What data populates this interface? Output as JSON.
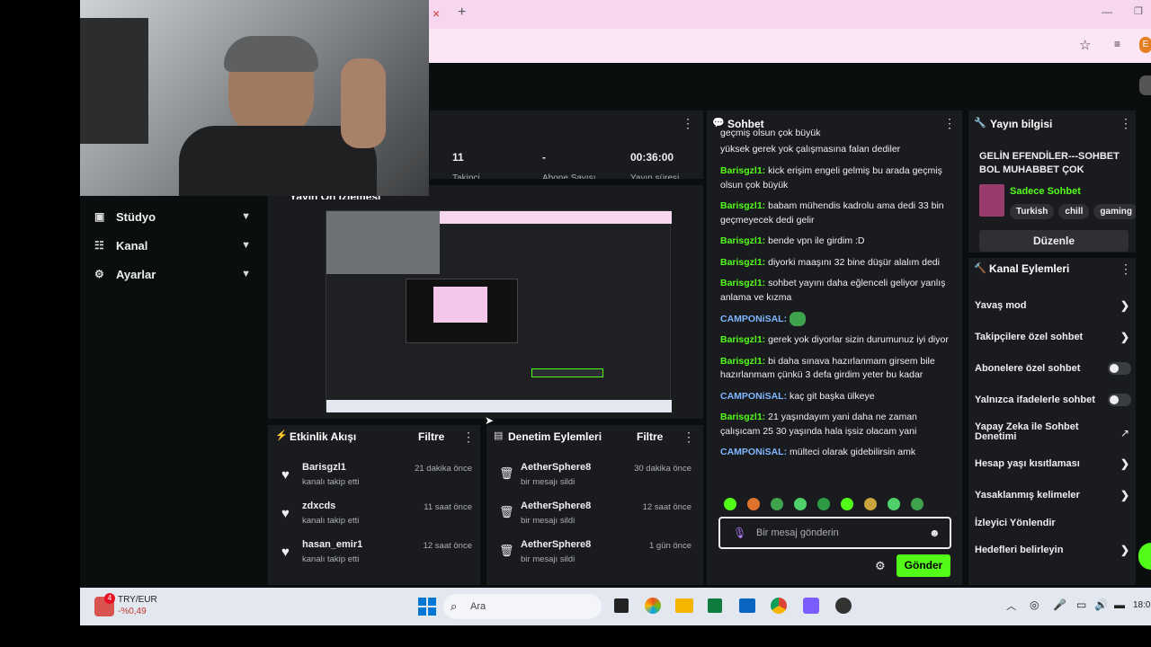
{
  "browser": {
    "close_tab_glyph": "×",
    "new_tab_glyph": "+",
    "profile_initial": "E"
  },
  "sidebar": {
    "items": [
      {
        "label": "Stüdyo"
      },
      {
        "label": "Kanal"
      },
      {
        "label": "Ayarlar"
      }
    ]
  },
  "stats": {
    "values": [
      "11",
      "-",
      "00:36:00"
    ],
    "labels_partial": [
      "Takipçi",
      "Abone Sayısı",
      "Yayın süresi"
    ]
  },
  "preview": {
    "title": "Yayın Ön İzlemesi"
  },
  "activity_feed": {
    "title": "Etkinlik Akışı",
    "filter_label": "Filtre",
    "rows": [
      {
        "name": "Barisgzl1",
        "action": "kanalı takip etti",
        "time": "21 dakika önce"
      },
      {
        "name": "zdxcds",
        "action": "kanalı takip etti",
        "time": "11 saat önce"
      },
      {
        "name": "hasan_emir1",
        "action": "kanalı takip etti",
        "time": "12 saat önce"
      }
    ]
  },
  "moderation": {
    "title": "Denetim Eylemleri",
    "filter_label": "Filtre",
    "rows": [
      {
        "name": "AetherSphere8",
        "action": "bir mesajı sildi",
        "time": "30 dakika önce"
      },
      {
        "name": "AetherSphere8",
        "action": "bir mesajı sildi",
        "time": "12 saat önce"
      },
      {
        "name": "AetherSphere8",
        "action": "bir mesajı sildi",
        "time": "1 gün önce"
      }
    ]
  },
  "chat": {
    "title": "Sohbet",
    "first_line_partial": "geçmiş olsun çok büyük",
    "top_text": "yüksek gerek yok çalışmasına falan dediler",
    "messages": [
      {
        "user": "Barisgzl1:",
        "text": "kick erişim engeli gelmiş bu arada geçmiş olsun çok büyük"
      },
      {
        "user": "Barisgzl1:",
        "text": "babam mühendis kadrolu ama dedi 33 bin geçmeyecek dedi gelir"
      },
      {
        "user": "Barisgzl1:",
        "text": "bende vpn ile girdim :D"
      },
      {
        "user": "Barisgzl1:",
        "text": "diyorki maaşını 32 bine düşür alalım dedi"
      },
      {
        "user": "Barisgzl1:",
        "text": "sohbet yayını daha eğlenceli geliyor yanlış anlama ve kızma"
      },
      {
        "user": "CAMPONiSAL:",
        "text": ""
      },
      {
        "user": "Barisgzl1:",
        "text": "gerek yok diyorlar sizin durumunuz iyi diyor"
      },
      {
        "user": "Barisgzl1:",
        "text": "bi daha sınava hazırlanmam girsem bile hazırlanmam çünkü 3 defa girdim yeter bu kadar"
      },
      {
        "user": "CAMPONiSAL:",
        "text": "kaç git başka ülkeye"
      },
      {
        "user": "Barisgzl1:",
        "text": "21 yaşındayım yani daha ne zaman çalışıcam 25 30 yaşında hala işsiz olacam yani"
      },
      {
        "user": "CAMPONiSAL:",
        "text": "mülteci olarak gidebilirsin amk"
      }
    ],
    "input_placeholder": "Bir mesaj gönderin",
    "send_label": "Gönder"
  },
  "stream_info": {
    "title": "Yayın bilgisi",
    "stream_title": "GELİN EFENDİLER---SOHBET BOL MUHABBET ÇOK",
    "category": "Sadece Sohbet",
    "tags": [
      "Turkish",
      "chill",
      "gaming"
    ],
    "edit_label": "Düzenle"
  },
  "channel_actions": {
    "title": "Kanal Eylemleri",
    "items": [
      {
        "label": "Yavaş mod",
        "kind": "arrow"
      },
      {
        "label": "Takipçilere özel sohbet",
        "kind": "arrow"
      },
      {
        "label": "Abonelere özel sohbet",
        "kind": "toggle"
      },
      {
        "label": "Yalnızca ifadelerle sohbet",
        "kind": "toggle"
      },
      {
        "label": "Yapay Zeka ile Sohbet Denetimi",
        "kind": "external"
      },
      {
        "label": "Hesap yaşı kısıtlaması",
        "kind": "arrow"
      },
      {
        "label": "Yasaklanmış kelimeler",
        "kind": "arrow"
      },
      {
        "label": "İzleyici Yönlendir",
        "kind": "none"
      },
      {
        "label": "Hedefleri belirleyin",
        "kind": "arrow"
      }
    ]
  },
  "taskbar": {
    "currency_pair": "TRY/EUR",
    "currency_change": "-%0,49",
    "badge_count": "4",
    "search_label": "Ara",
    "clock_partial": "18:0"
  },
  "colors": {
    "accent": "#53fc18",
    "panel": "#191b1f",
    "background": "#0b0e0f",
    "tabbar": "#f6d7ef"
  }
}
